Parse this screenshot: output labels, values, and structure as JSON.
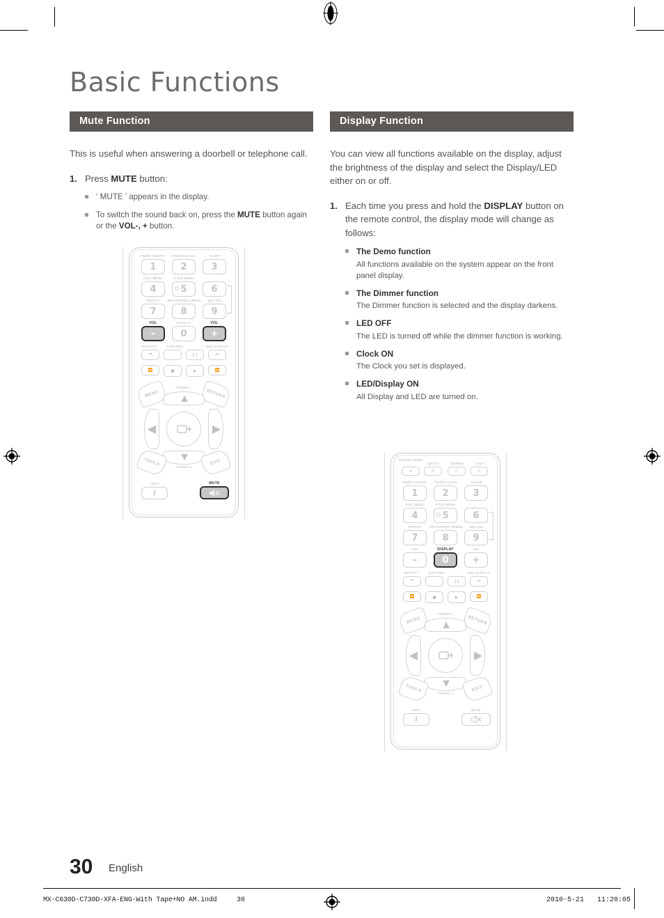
{
  "page": {
    "title": "Basic Functions",
    "number": "30",
    "language": "English"
  },
  "footer": {
    "filename": "MX-C630D-C730D-XFA-ENG-With Tape+NO AM.indd",
    "page_ref": "30",
    "date": "2010-5-21",
    "time": "11:20:05"
  },
  "colors": {
    "section_bar": "#5b5855",
    "body_text": "#545251",
    "title": "#6e6c6a",
    "key_outline": "#cfcfcf",
    "key_highlight_fill": "#c9c7c5",
    "key_highlight_border": "#2f2f2f"
  },
  "left_column": {
    "section_title": "Mute Function",
    "intro": "This is useful when answering a doorbell or telephone call.",
    "steps": [
      {
        "number": "1.",
        "text_parts": [
          {
            "t": "Press ",
            "b": false
          },
          {
            "t": "MUTE",
            "b": true
          },
          {
            "t": " button:",
            "b": false
          }
        ],
        "subitems": [
          {
            "parts": [
              {
                "t": "‘ MUTE ’ appears in the display.",
                "b": false
              }
            ]
          },
          {
            "parts": [
              {
                "t": "To switch the sound back on, press the ",
                "b": false
              },
              {
                "t": "MUTE",
                "b": true
              },
              {
                "t": " button again or the ",
                "b": false
              },
              {
                "t": "VOL-, +",
                "b": true
              },
              {
                "t": " button.",
                "b": false
              }
            ]
          }
        ]
      }
    ],
    "figure": {
      "name": "remote-control-mute",
      "highlighted_keys": [
        "VOL -",
        "VOL +",
        "MUTE"
      ]
    }
  },
  "right_column": {
    "section_title": "Display Function",
    "intro": "You can view all functions available on the display, adjust the brightness of the display and select the Display/LED either on or off.",
    "steps": [
      {
        "number": "1.",
        "text_parts": [
          {
            "t": "Each time you press and hold the ",
            "b": false
          },
          {
            "t": "DISPLAY",
            "b": true
          },
          {
            "t": " button on the remote control, the display mode will change as follows:",
            "b": false
          }
        ],
        "subitems": [
          {
            "title": "The Demo function",
            "desc": "All functions available on the system appear on the front panel display."
          },
          {
            "title": "The Dimmer function",
            "desc": "The Dimmer function is selected and the display darkens."
          },
          {
            "title": "LED OFF",
            "desc": "The LED is turned off while the dimmer function is working."
          },
          {
            "title": "Clock ON",
            "desc": "The Clock you set is displayed."
          },
          {
            "title": "LED/Display ON",
            "desc": "All Display and LED are turned on."
          }
        ]
      }
    ],
    "figure": {
      "name": "remote-control-display",
      "highlighted_keys": [
        "DISPLAY 0"
      ]
    }
  },
  "remote_left": {
    "top_labels": [
      "TIMER ON/OFF",
      "TIMER/CLOCK",
      "SLEEP"
    ],
    "row2_labels": [
      "DISC MENU",
      "TITLE MENU",
      ""
    ],
    "row3_labels": [
      "REPEAT",
      "RECORDING SPEED",
      "MIC VOL"
    ],
    "row4_labels": [
      "VOL",
      "DISPLAY",
      "VOL"
    ],
    "numbers": [
      "1",
      "2",
      "3",
      "4",
      "5",
      "6",
      "7",
      "8",
      "9"
    ],
    "vol_minus": "–",
    "zero": "0",
    "vol_plus": "+",
    "mic_plus": "+",
    "mic_minus": "–",
    "transport_labels": [
      "RDS PTY",
      "TAPE REC",
      "RDS DISPLAY"
    ],
    "nav_labels": {
      "menu": "MENU",
      "return": "RETURN",
      "tools": "TOOLS",
      "exit": "EXIT",
      "tuning_up": "TUNING ^",
      "tuning_down": "TUNING ∨"
    },
    "bottom_labels": {
      "info": "INFO",
      "mute": "MUTE"
    }
  },
  "remote_right": {
    "abcd_labels": [
      "TUNING MODE",
      "MO/ST",
      "DSP/EQ",
      "GIGA"
    ],
    "abcd_keys": [
      "A",
      "B",
      "C",
      "D"
    ],
    "top_labels": [
      "TIMER ON/OFF",
      "TIMER/CLOCK",
      "SLEEP"
    ],
    "row2_labels": [
      "DISC MENU",
      "TITLE MENU",
      ""
    ],
    "row3_labels": [
      "REPEAT",
      "RECORDING SPEED",
      "MIC VOL"
    ],
    "row4_labels": [
      "VOL",
      "DISPLAY",
      "VOL"
    ],
    "numbers": [
      "1",
      "2",
      "3",
      "4",
      "5",
      "6",
      "7",
      "8",
      "9"
    ],
    "vol_minus": "–",
    "zero": "0",
    "vol_plus": "+",
    "mic_plus": "+",
    "mic_minus": "–",
    "transport_labels": [
      "RDS PTY",
      "TAPE REC",
      "RDS DISPLAY"
    ],
    "nav_labels": {
      "menu": "MENU",
      "return": "RETURN",
      "tools": "TOOLS",
      "exit": "EXIT",
      "tuning_up": "TUNING ^",
      "tuning_down": "TUNING ∨"
    },
    "bottom_labels": {
      "info": "INFO",
      "mute": "MUTE"
    }
  }
}
